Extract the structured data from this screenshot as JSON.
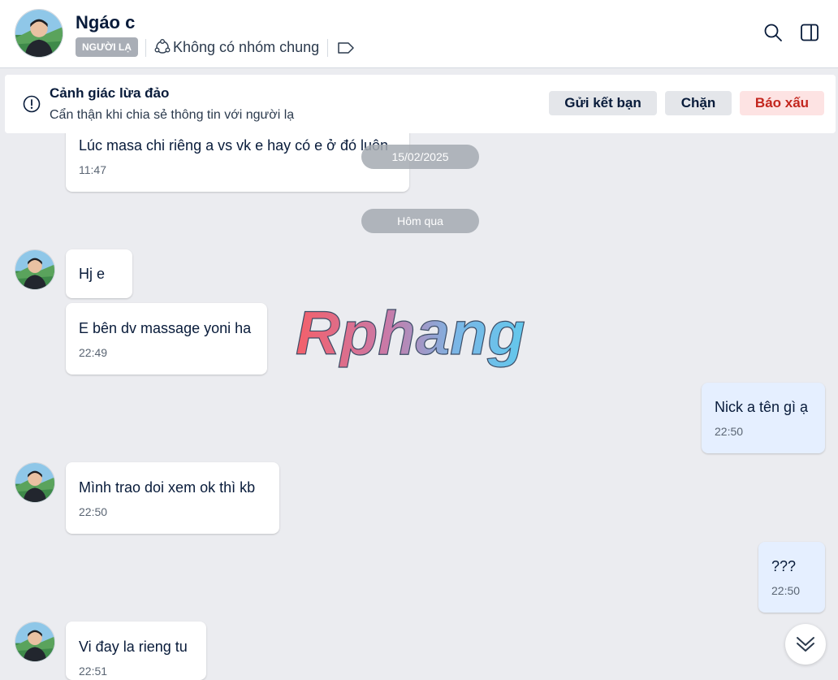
{
  "header": {
    "name": "Ngáo c",
    "badge": "NGƯỜI LẠ",
    "groups_text": "Không có nhóm chung",
    "icons": [
      "group-icon",
      "tag-icon",
      "search-icon",
      "sidebar-toggle-icon"
    ]
  },
  "alert": {
    "title": "Cảnh giác lừa đảo",
    "subtitle": "Cẩn thận khi chia sẻ thông tin với người lạ",
    "add_friend": "Gửi kết bạn",
    "block": "Chặn",
    "report": "Báo xấu"
  },
  "date_chips": {
    "first": "15/02/2025",
    "second": "Hôm qua"
  },
  "messages": [
    {
      "dir": "in",
      "text": "Lúc masa chi riêng a vs vk e hay có e ở đó luôn",
      "time": "11:47"
    },
    {
      "dir": "in",
      "text": "Hj e",
      "time": ""
    },
    {
      "dir": "in",
      "text": "E bên dv massage yoni ha",
      "time": "22:49"
    },
    {
      "dir": "out",
      "text": "Nick a tên gì ạ",
      "time": "22:50"
    },
    {
      "dir": "in",
      "text": "Mình trao doi xem ok thì kb",
      "time": "22:50"
    },
    {
      "dir": "out",
      "text": "???",
      "time": "22:50"
    },
    {
      "dir": "in",
      "text": "Vi đay la rieng tu",
      "time": "22:51"
    }
  ],
  "watermark": "Rphang",
  "colors": {
    "accent_blue": "#0068ff",
    "incoming_bubble": "#ffffff",
    "outgoing_bubble": "#e5efff",
    "chat_background": "#ebecf0",
    "report_red": "#c3261e"
  }
}
